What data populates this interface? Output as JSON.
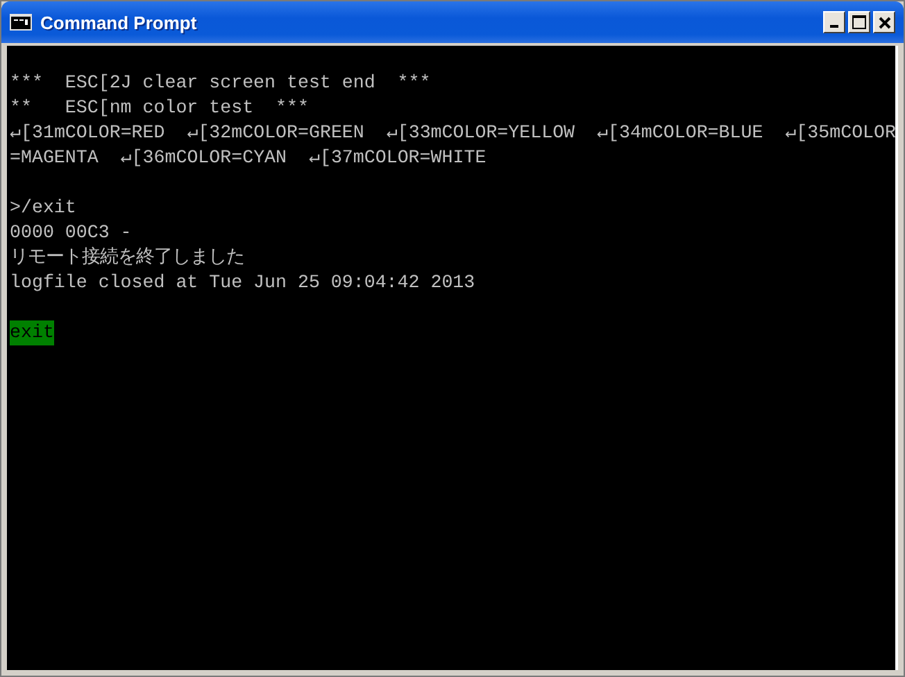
{
  "window": {
    "title": "Command Prompt"
  },
  "lines": [
    {
      "kind": "blank"
    },
    {
      "kind": "output",
      "text": "***  ESC[2J clear screen test end  ***"
    },
    {
      "kind": "output",
      "text": "**   ESC[nm color test  ***"
    },
    {
      "kind": "output",
      "text": "↵[31mCOLOR=RED  ↵[32mCOLOR=GREEN  ↵[33mCOLOR=YELLOW  ↵[34mCOLOR=BLUE  ↵[35mCOLOR"
    },
    {
      "kind": "output",
      "text": "=MAGENTA  ↵[36mCOLOR=CYAN  ↵[37mCOLOR=WHITE"
    },
    {
      "kind": "blank"
    },
    {
      "kind": "output",
      "text": ">/exit"
    },
    {
      "kind": "output",
      "text": "0000 00C3 -"
    },
    {
      "kind": "output",
      "text": "リモート接続を終了しました"
    },
    {
      "kind": "output",
      "text": "logfile closed at Tue Jun 25 09:04:42 2013"
    },
    {
      "kind": "blank"
    },
    {
      "kind": "highlighted",
      "text": "exit"
    }
  ]
}
